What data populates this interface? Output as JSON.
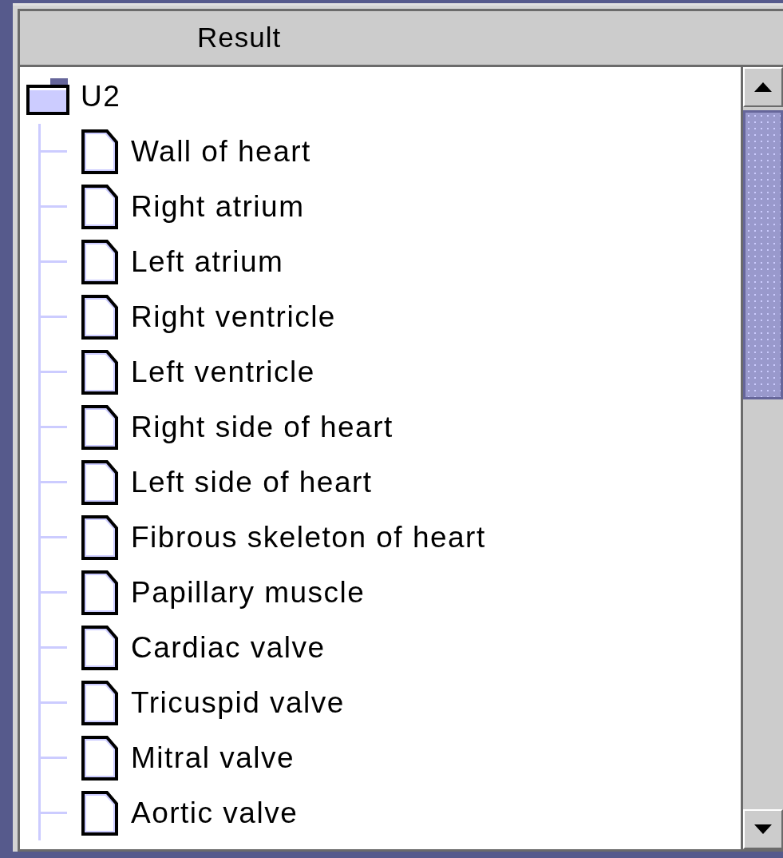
{
  "header": {
    "title": "Result"
  },
  "tree": [
    {
      "label": "U2",
      "kind": "folder",
      "children": [
        {
          "label": "Wall of heart",
          "kind": "leaf"
        },
        {
          "label": "Right atrium",
          "kind": "leaf"
        },
        {
          "label": "Left atrium",
          "kind": "leaf"
        },
        {
          "label": "Right ventricle",
          "kind": "leaf"
        },
        {
          "label": "Left ventricle",
          "kind": "leaf"
        },
        {
          "label": "Right side of heart",
          "kind": "leaf"
        },
        {
          "label": "Left side of heart",
          "kind": "leaf"
        },
        {
          "label": "Fibrous skeleton of heart",
          "kind": "leaf"
        },
        {
          "label": "Papillary muscle",
          "kind": "leaf"
        },
        {
          "label": "Cardiac valve",
          "kind": "leaf"
        },
        {
          "label": "Tricuspid valve",
          "kind": "leaf"
        },
        {
          "label": "Mitral valve",
          "kind": "leaf"
        },
        {
          "label": "Aortic valve",
          "kind": "leaf"
        }
      ]
    }
  ]
}
